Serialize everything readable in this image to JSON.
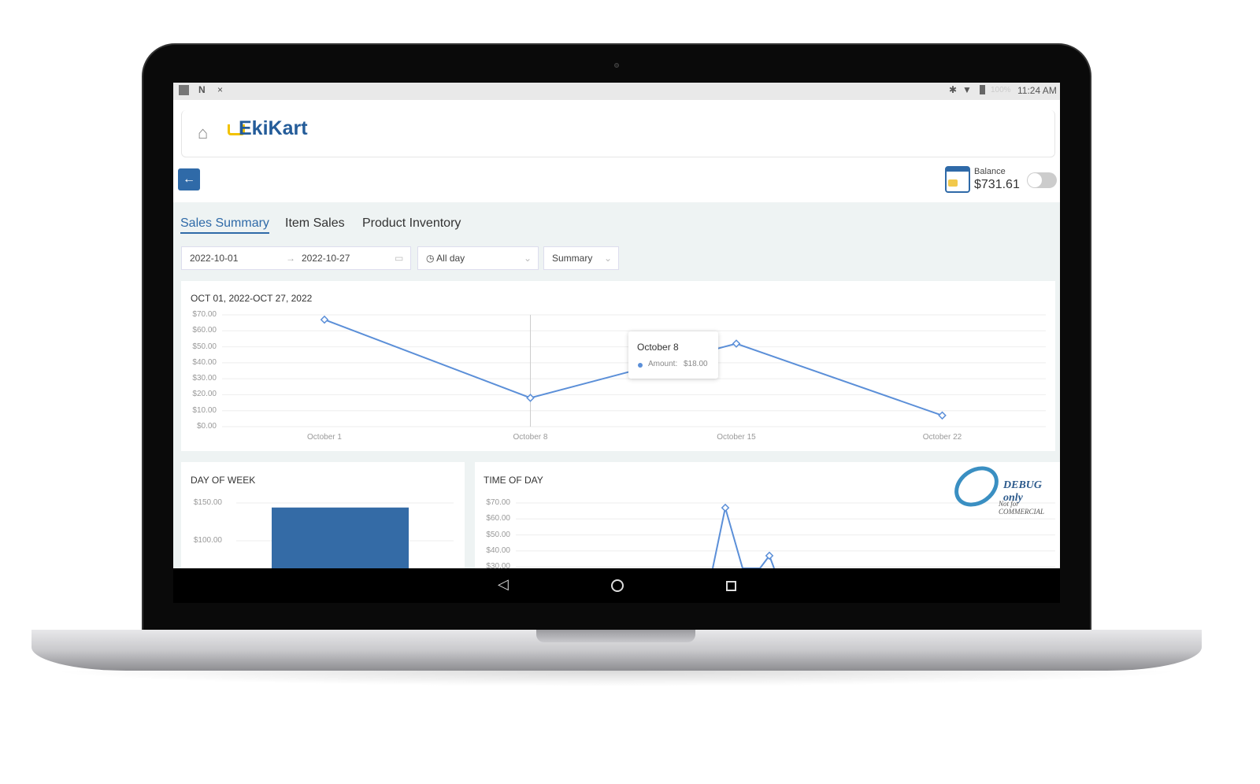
{
  "status_bar": {
    "time": "11:24 AM",
    "battery": "100%",
    "icons": [
      "sim-icon",
      "n-icon",
      "close-icon",
      "bluetooth-icon",
      "wifi-icon",
      "battery-icon"
    ]
  },
  "header": {
    "logo": "EkiKart",
    "balance_label": "Balance",
    "balance_value": "$731.61"
  },
  "tabs": [
    {
      "label": "Sales Summary",
      "active": true
    },
    {
      "label": "Item Sales"
    },
    {
      "label": "Product Inventory"
    }
  ],
  "filters": {
    "start_date": "2022-10-01",
    "end_date": "2022-10-27",
    "time_range": "All day",
    "view": "Summary"
  },
  "colors": {
    "accent": "#2f6aa8",
    "line": "#5b8fd8",
    "bar": "#346ba6"
  },
  "watermark": {
    "text": "DEBUG only",
    "subtext": "Not for COMMERCIAL"
  },
  "chart_data": [
    {
      "type": "line",
      "title": "OCT 01, 2022-OCT 27, 2022",
      "x": [
        "October 1",
        "October 8",
        "October 15",
        "October 22"
      ],
      "series": [
        {
          "name": "Amount",
          "values": [
            67,
            18,
            52,
            7
          ]
        }
      ],
      "yticks": [
        "$0.00",
        "$10.00",
        "$20.00",
        "$30.00",
        "$40.00",
        "$50.00",
        "$60.00",
        "$70.00"
      ],
      "ylim": [
        0,
        70
      ],
      "grid": true,
      "tooltip": {
        "title": "October 8",
        "label": "Amount:",
        "value": "$18.00"
      }
    },
    {
      "type": "bar",
      "title": "DAY OF WEEK",
      "values": [
        144
      ],
      "yticks": [
        "$100.00",
        "$150.00"
      ],
      "grid": true
    },
    {
      "type": "line",
      "title": "TIME OF DAY",
      "values": [
        67,
        37
      ],
      "yticks": [
        "$30.00",
        "$40.00",
        "$50.00",
        "$60.00",
        "$70.00"
      ],
      "grid": true
    }
  ]
}
